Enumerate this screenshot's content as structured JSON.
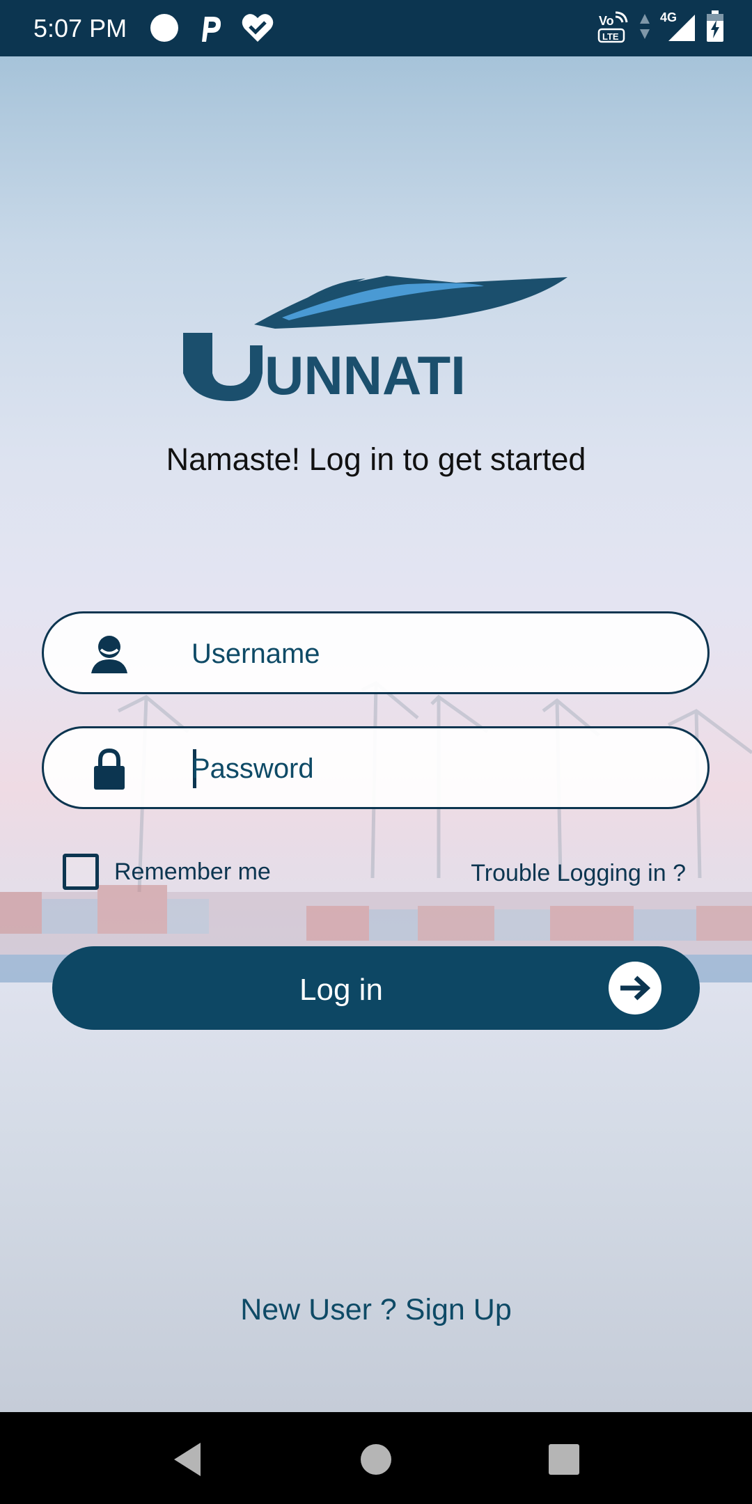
{
  "status_bar": {
    "time": "5:07 PM",
    "network": "4G",
    "volte": "Vo LTE"
  },
  "app": {
    "logo_text": "UNNATI",
    "tagline": "Namaste! Log in to get started"
  },
  "form": {
    "username_placeholder": "Username",
    "password_placeholder": "Password",
    "remember_label": "Remember me",
    "trouble_link": "Trouble Logging in ?",
    "login_label": "Log in",
    "signup_link": "New User ? Sign Up"
  },
  "colors": {
    "brand_dark": "#0c3550",
    "brand_button": "#0d4764",
    "brand_accent": "#4a9ad4"
  }
}
